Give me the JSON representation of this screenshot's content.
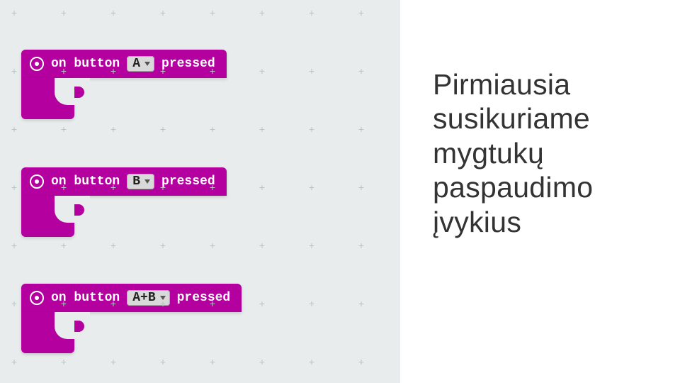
{
  "slide": {
    "text": "Pirmiausia susikuriame mygtukų paspaudimo įvykius"
  },
  "blocks": [
    {
      "prefix": "on button",
      "value": "A",
      "suffix": "pressed"
    },
    {
      "prefix": "on button",
      "value": "B",
      "suffix": "pressed"
    },
    {
      "prefix": "on button",
      "value": "A+B",
      "suffix": "pressed"
    }
  ],
  "icons": {
    "event": "target-icon",
    "dd": "chevron-down-icon"
  }
}
